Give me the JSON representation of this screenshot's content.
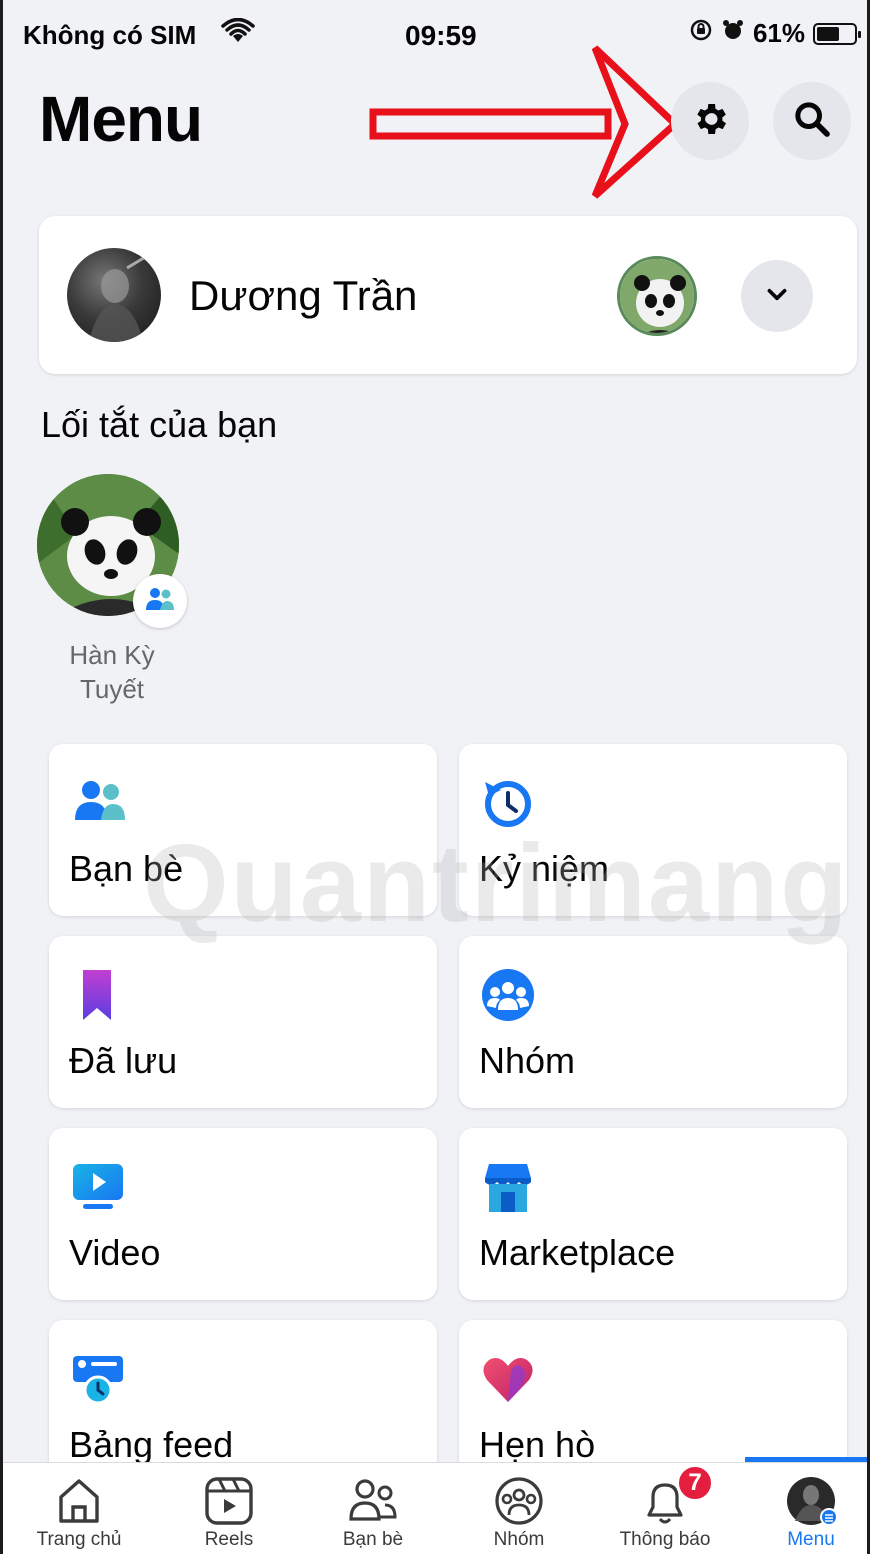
{
  "status_bar": {
    "carrier": "Không có SIM",
    "time": "09:59",
    "battery": "61%",
    "battery_level": 0.61
  },
  "header": {
    "title": "Menu"
  },
  "profile": {
    "name": "Dương Trần"
  },
  "shortcuts": {
    "title": "Lối tắt của bạn",
    "items": [
      {
        "label": "Hàn Kỳ Tuyết"
      }
    ]
  },
  "tiles": [
    {
      "label": "Bạn bè",
      "icon": "friends-icon"
    },
    {
      "label": "Kỷ niệm",
      "icon": "memories-icon"
    },
    {
      "label": "Đã lưu",
      "icon": "saved-icon"
    },
    {
      "label": "Nhóm",
      "icon": "groups-icon"
    },
    {
      "label": "Video",
      "icon": "video-icon"
    },
    {
      "label": "Marketplace",
      "icon": "marketplace-icon"
    },
    {
      "label": "Bảng feed",
      "icon": "feeds-icon"
    },
    {
      "label": "Hẹn hò",
      "icon": "dating-icon"
    }
  ],
  "watermark": "Quantrimang",
  "bottom_nav": [
    {
      "label": "Trang chủ"
    },
    {
      "label": "Reels"
    },
    {
      "label": "Bạn bè"
    },
    {
      "label": "Nhóm"
    },
    {
      "label": "Thông báo",
      "badge": "7"
    },
    {
      "label": "Menu"
    }
  ],
  "colors": {
    "accent": "#1877f2",
    "background": "#f0f2f5",
    "badge": "#e41e3f",
    "annotation": "#e8101a"
  }
}
